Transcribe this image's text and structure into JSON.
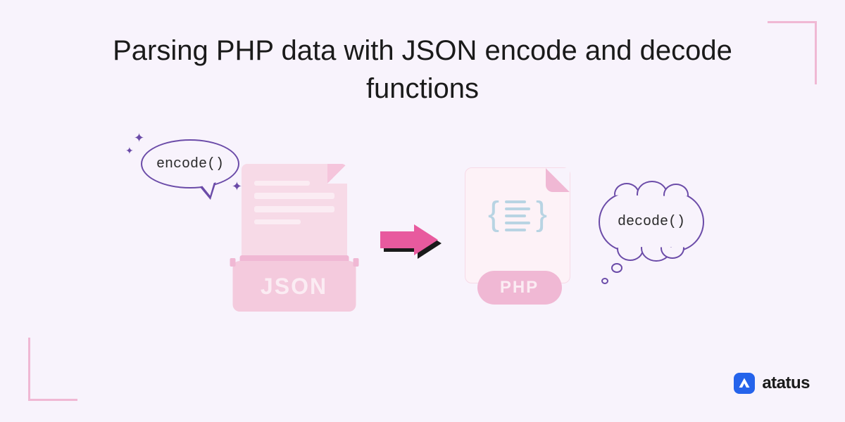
{
  "title": "Parsing PHP data with JSON encode and decode functions",
  "encode_label": "encode()",
  "decode_label": "decode()",
  "json_label": "JSON",
  "php_label": "PHP",
  "brand": {
    "name": "atatus",
    "icon_letter": "A"
  },
  "colors": {
    "bg": "#f8f3fc",
    "pink_light": "#f7dae7",
    "pink_mid": "#f0b8d4",
    "pink_accent": "#e85a9e",
    "purple": "#6b4ba8",
    "blue": "#2563eb"
  }
}
